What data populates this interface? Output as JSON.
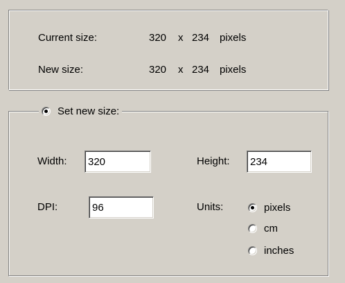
{
  "info": {
    "current": {
      "label": "Current size:",
      "width": "320",
      "sep": "x",
      "height": "234",
      "unit": "pixels"
    },
    "new": {
      "label": "New size:",
      "width": "320",
      "sep": "x",
      "height": "234",
      "unit": "pixels"
    }
  },
  "group": {
    "label": "Set new size:",
    "selected": true
  },
  "fields": {
    "width_label": "Width:",
    "width_value": "320",
    "height_label": "Height:",
    "height_value": "234",
    "dpi_label": "DPI:",
    "dpi_value": "96",
    "units_label": "Units:"
  },
  "units": {
    "selected": "pixels",
    "options": [
      "pixels",
      "cm",
      "inches"
    ]
  },
  "colors": {
    "face": "#d4d0c8",
    "shadow": "#808080",
    "highlight": "#ffffff"
  }
}
